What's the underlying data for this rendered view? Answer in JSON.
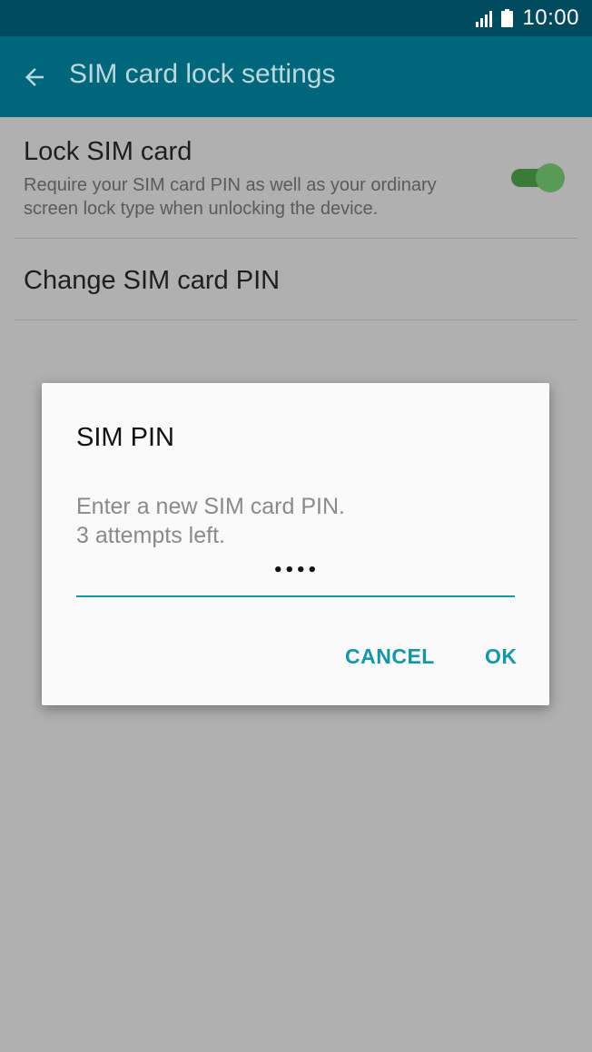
{
  "status_bar": {
    "time": "10:00",
    "signal_icon": "signal-bars-icon",
    "battery_icon": "battery-full-icon"
  },
  "app_bar": {
    "back_icon": "arrow-back-icon",
    "title": "SIM card lock settings",
    "background": "#00667a"
  },
  "preferences": {
    "lock_sim": {
      "title": "Lock SIM card",
      "summary": "Require your SIM card PIN as well as your ordinary screen lock type when unlocking the device.",
      "toggle_on": true
    },
    "change_pin": {
      "title": "Change SIM card PIN"
    }
  },
  "dialog": {
    "title": "SIM PIN",
    "message_line1": "Enter a new SIM card PIN.",
    "message_line2": "3 attempts left.",
    "pin_value": "••••",
    "cancel_label": "CANCEL",
    "ok_label": "OK",
    "accent": "#1296a8"
  }
}
